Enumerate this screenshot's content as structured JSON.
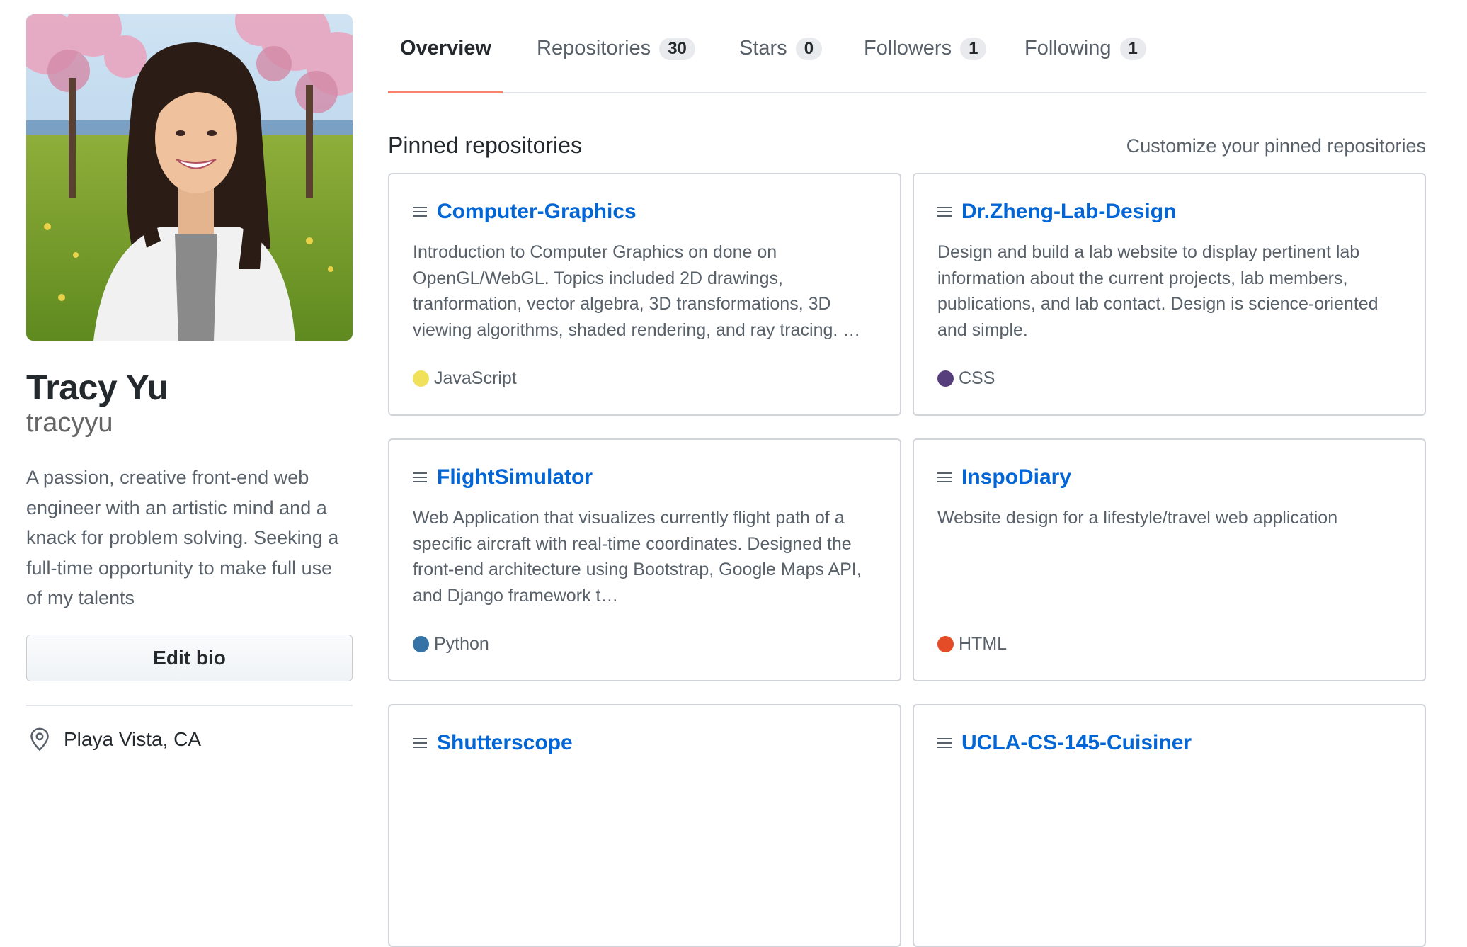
{
  "profile": {
    "name": "Tracy Yu",
    "login": "tracyyu",
    "bio": "A passion, creative front-end web engineer with an artistic mind and a knack for problem solving. Seeking a full-time opportunity to make full use of my talents",
    "edit_bio_label": "Edit bio",
    "location": "Playa Vista, CA",
    "location_icon": "location-pin-icon"
  },
  "tabs": [
    {
      "label": "Overview",
      "count": "",
      "selected": true
    },
    {
      "label": "Repositories",
      "count": "30"
    },
    {
      "label": "Stars",
      "count": "0"
    },
    {
      "label": "Followers",
      "count": "1"
    },
    {
      "label": "Following",
      "count": "1"
    }
  ],
  "pinned": {
    "title": "Pinned repositories",
    "customize_label": "Customize your pinned repositories",
    "repos": [
      {
        "name": "Computer-Graphics",
        "description": "Introduction to Computer Graphics on done on OpenGL/WebGL. Topics included 2D drawings, tranformation, vector algebra, 3D transformations, 3D viewing algorithms, shaded rendering, and ray tracing. …",
        "language": "JavaScript",
        "language_color": "#f1e05a"
      },
      {
        "name": "Dr.Zheng-Lab-Design",
        "description": "Design and build a lab website to display pertinent lab information about the current projects, lab members, publications, and lab contact. Design is science-oriented and simple.",
        "language": "CSS",
        "language_color": "#563d7c"
      },
      {
        "name": "FlightSimulator",
        "description": "Web Application that visualizes currently flight path of a specific aircraft with real-time coordinates. Designed the front-end architecture using Bootstrap, Google Maps API, and Django framework t…",
        "language": "Python",
        "language_color": "#3572a5"
      },
      {
        "name": "InspoDiary",
        "description": "Website design for a lifestyle/travel web application",
        "language": "HTML",
        "language_color": "#e34c26"
      },
      {
        "name": "Shutterscope",
        "description": "",
        "language": "",
        "language_color": ""
      },
      {
        "name": "UCLA-CS-145-Cuisiner",
        "description": "",
        "language": "",
        "language_color": ""
      }
    ]
  },
  "colors": {
    "link": "#0366d6",
    "tab_underline": "#f9826c",
    "border": "#d1d5da"
  }
}
